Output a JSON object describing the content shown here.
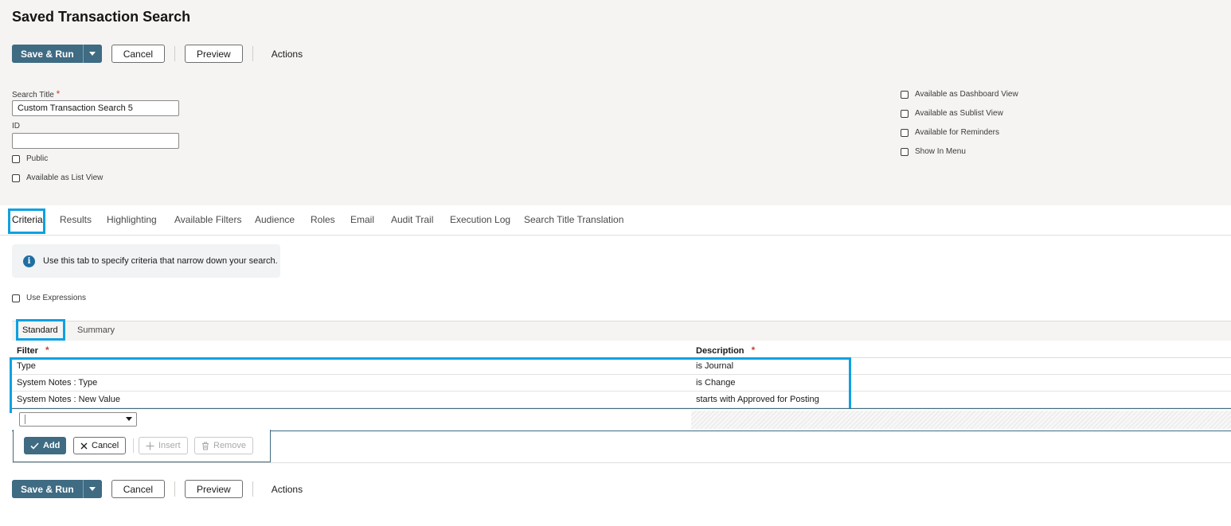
{
  "page": {
    "title": "Saved Transaction Search"
  },
  "toolbar": {
    "save_run": "Save & Run",
    "cancel": "Cancel",
    "preview": "Preview",
    "actions": "Actions"
  },
  "form": {
    "search_title": {
      "label": "Search Title",
      "required_mark": "*",
      "value": "Custom Transaction Search 5"
    },
    "id": {
      "label": "ID",
      "value": ""
    },
    "public": {
      "label": "Public",
      "checked": false
    },
    "list_view": {
      "label": "Available as List View",
      "checked": false
    },
    "right_options": [
      {
        "label": "Available as Dashboard View",
        "checked": false
      },
      {
        "label": "Available as Sublist View",
        "checked": false
      },
      {
        "label": "Available for Reminders",
        "checked": false
      },
      {
        "label": "Show In Menu",
        "checked": false
      }
    ]
  },
  "tabs": [
    {
      "label": "Criteria",
      "active": true
    },
    {
      "label": "Results"
    },
    {
      "label": "Highlighting"
    },
    {
      "label": "Available Filters"
    },
    {
      "label": "Audience"
    },
    {
      "label": "Roles"
    },
    {
      "label": "Email"
    },
    {
      "label": "Audit Trail"
    },
    {
      "label": "Execution Log"
    },
    {
      "label": "Search Title Translation"
    }
  ],
  "criteria": {
    "info": "Use this tab to specify criteria that narrow down your search.",
    "use_expressions": "Use Expressions",
    "subtabs": [
      {
        "label": "Standard",
        "active": true
      },
      {
        "label": "Summary"
      }
    ],
    "columns": {
      "filter": "Filter",
      "description": "Description",
      "required_mark": "*"
    },
    "rows": [
      {
        "filter": "Type",
        "description": "is Journal"
      },
      {
        "filter": "System Notes : Type",
        "description": "is Change"
      },
      {
        "filter": "System Notes : New Value",
        "description": "starts with Approved for Posting"
      }
    ],
    "edit_actions": {
      "add": "Add",
      "cancel": "Cancel",
      "insert": "Insert",
      "remove": "Remove"
    }
  },
  "colors": {
    "primary": "#3f6b83",
    "highlight": "#0ea1e0",
    "required": "#c74634",
    "info": "#1f6fa1"
  }
}
